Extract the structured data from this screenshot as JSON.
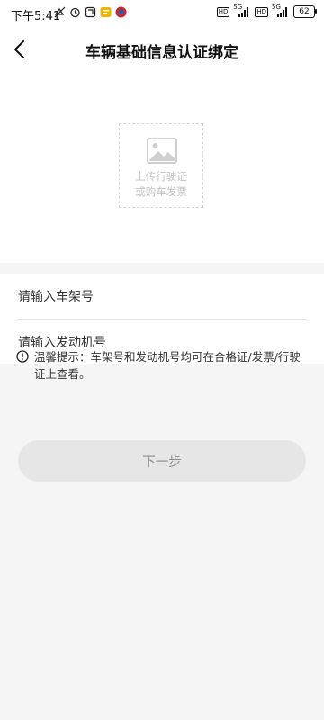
{
  "status_bar": {
    "time": "下午5:41",
    "hd_1": "HD",
    "hd_2": "HD",
    "network_1": "5G",
    "network_2": "5G",
    "battery": "62"
  },
  "header": {
    "title": "车辆基础信息认证绑定",
    "back_icon": "chevron-left-icon"
  },
  "upload": {
    "icon": "image-icon",
    "line1": "上传行驶证",
    "line2": "或购车发票"
  },
  "form": {
    "frame_number_placeholder": "请输入车架号",
    "engine_number_placeholder": "请输入发动机号"
  },
  "tip": {
    "icon": "info-circle-icon",
    "text": "温馨提示：车架号和发动机号均可在合格证/发票/行驶证上查看。"
  },
  "actions": {
    "next_label": "下一步"
  },
  "colors": {
    "background": "#f5f5f5",
    "button_disabled_bg": "#e6e6e6",
    "button_disabled_text": "#8e8e8e",
    "placeholder_gray": "#c2c2c2"
  }
}
